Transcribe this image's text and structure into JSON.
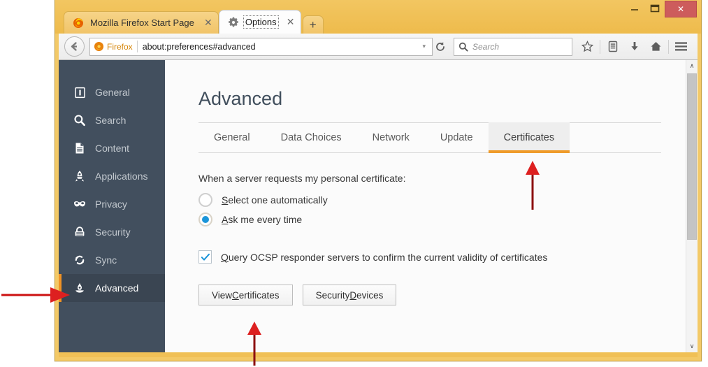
{
  "window": {
    "controls": {
      "minimize": "minimize-button",
      "maximize": "maximize-button",
      "close": "✕"
    }
  },
  "tabs": [
    {
      "label": "Mozilla Firefox Start Page",
      "icon": "firefox-logo-icon",
      "active": false,
      "close": "✕"
    },
    {
      "label": "Options",
      "icon": "gear-icon",
      "active": true,
      "close": "✕"
    }
  ],
  "newtab_label": "+",
  "navbar": {
    "back_icon": "back-arrow-icon",
    "identity_label": "Firefox",
    "url": "about:preferences#advanced",
    "dropdown_icon": "chevron-down-icon",
    "reload_icon": "reload-icon",
    "search_placeholder": "Search",
    "search_value": "",
    "search_icon": "search-icon",
    "icons": [
      {
        "name": "bookmark-star-icon",
        "glyph": "☆"
      },
      {
        "name": "reader-list-icon",
        "glyph": "▤"
      },
      {
        "name": "downloads-icon",
        "glyph": "⬇"
      },
      {
        "name": "home-icon",
        "glyph": "⌂"
      },
      {
        "name": "hamburger-menu-icon",
        "glyph": "☰"
      }
    ]
  },
  "sidebar": {
    "items": [
      {
        "label": "General",
        "icon": "general-icon",
        "selected": false
      },
      {
        "label": "Search",
        "icon": "search-icon",
        "selected": false
      },
      {
        "label": "Content",
        "icon": "content-page-icon",
        "selected": false
      },
      {
        "label": "Applications",
        "icon": "rocket-icon",
        "selected": false
      },
      {
        "label": "Privacy",
        "icon": "mask-icon",
        "selected": false
      },
      {
        "label": "Security",
        "icon": "lock-icon",
        "selected": false
      },
      {
        "label": "Sync",
        "icon": "sync-refresh-icon",
        "selected": false
      },
      {
        "label": "Advanced",
        "icon": "advanced-gear-icon",
        "selected": true
      }
    ]
  },
  "main": {
    "title": "Advanced",
    "tabs": [
      {
        "label": "General",
        "active": false
      },
      {
        "label": "Data Choices",
        "active": false
      },
      {
        "label": "Network",
        "active": false
      },
      {
        "label": "Update",
        "active": false
      },
      {
        "label": "Certificates",
        "active": true
      }
    ],
    "certificates": {
      "request_label": "When a server requests my personal certificate:",
      "radios": [
        {
          "label_pre": "",
          "label_accel": "S",
          "label_post": "elect one automatically",
          "checked": false
        },
        {
          "label_pre": "",
          "label_accel": "A",
          "label_post": "sk me every time",
          "checked": true
        }
      ],
      "ocsp": {
        "accel": "Q",
        "text_post": "uery OCSP responder servers to confirm the current validity of certificates",
        "checked": true,
        "check_glyph": "✓"
      },
      "buttons": [
        {
          "pre": "View ",
          "accel": "C",
          "post": "ertificates"
        },
        {
          "pre": "Security ",
          "accel": "D",
          "post": "evices"
        }
      ]
    }
  },
  "scrollbar": {
    "up_glyph": "∧",
    "down_glyph": "∨",
    "thumb_percent": "62"
  },
  "annotations": {
    "color": "#cc1111",
    "arrows": [
      {
        "name": "arrow-to-advanced-sidebar",
        "direction": "right"
      },
      {
        "name": "arrow-to-certificates-tab",
        "direction": "up"
      },
      {
        "name": "arrow-to-view-certificates-button",
        "direction": "up"
      }
    ]
  },
  "colors": {
    "window_chrome": "#f0c056",
    "sidebar_bg": "#424f5e",
    "sidebar_selected_bg": "#3a4552",
    "accent_orange": "#f09224",
    "radio_blue": "#1b95d9",
    "close_red": "#cd5c5c",
    "annotation_red": "#cc1111"
  }
}
